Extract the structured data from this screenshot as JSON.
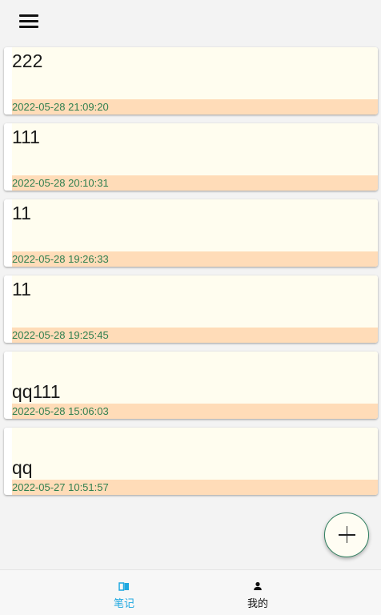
{
  "toolbar": {
    "menu_icon": "menu-icon"
  },
  "notes": [
    {
      "title": "222",
      "time": "2022-05-28 21:09:20"
    },
    {
      "title": "111",
      "time": "2022-05-28 20:10:31"
    },
    {
      "title": "11",
      "time": "2022-05-28 19:26:33"
    },
    {
      "title": "11",
      "time": "2022-05-28 19:25:45"
    },
    {
      "title": "qq111",
      "time": "2022-05-28 15:06:03"
    },
    {
      "title": "qq",
      "time": "2022-05-27 10:51:57"
    }
  ],
  "fab": {
    "icon": "plus-icon"
  },
  "bottom_nav": {
    "notes_label": "笔记",
    "mine_label": "我的",
    "notes_icon": "book-icon",
    "mine_icon": "person-icon"
  },
  "colors": {
    "active_tab": "#1fa8e0",
    "card_body": "#fffdef",
    "time_bar": "#ffdcb8",
    "time_text": "#2f7f4f"
  }
}
